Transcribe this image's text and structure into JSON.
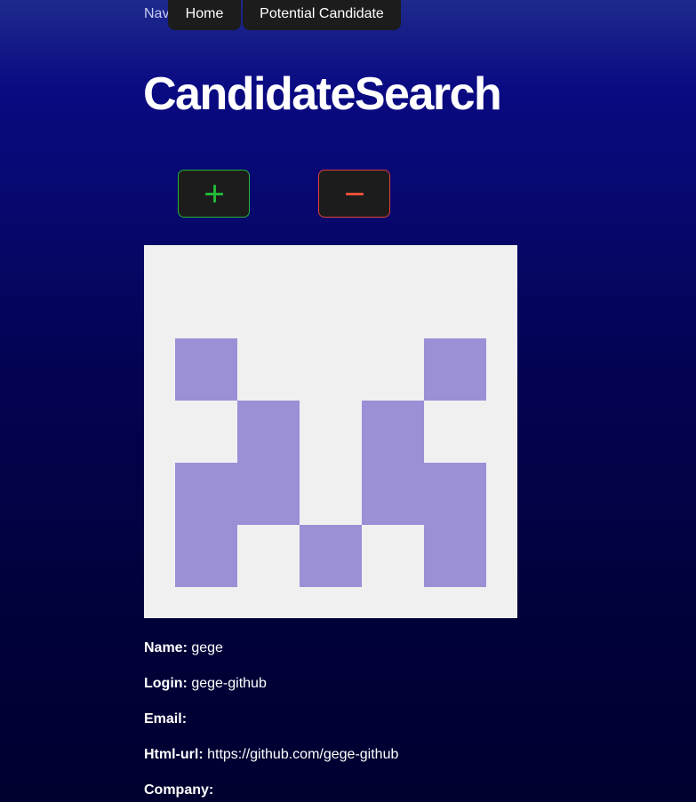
{
  "nav": {
    "label": "Nav",
    "links": [
      {
        "label": "Home"
      },
      {
        "label": "Potential Candidate"
      }
    ]
  },
  "page": {
    "title": "CandidateSearch"
  },
  "actions": {
    "add_icon": "plus-icon",
    "remove_icon": "minus-icon",
    "add_color": "#24b337",
    "remove_color": "#e2413a"
  },
  "avatar": {
    "background": "#f0f0f0",
    "color": "#9b8fd6"
  },
  "candidate": {
    "fields": [
      {
        "label": "Name:",
        "value": "gege"
      },
      {
        "label": "Login:",
        "value": "gege-github"
      },
      {
        "label": "Email:",
        "value": ""
      },
      {
        "label": "Html-url:",
        "value": "https://github.com/gege-github"
      },
      {
        "label": "Company:",
        "value": ""
      }
    ]
  }
}
